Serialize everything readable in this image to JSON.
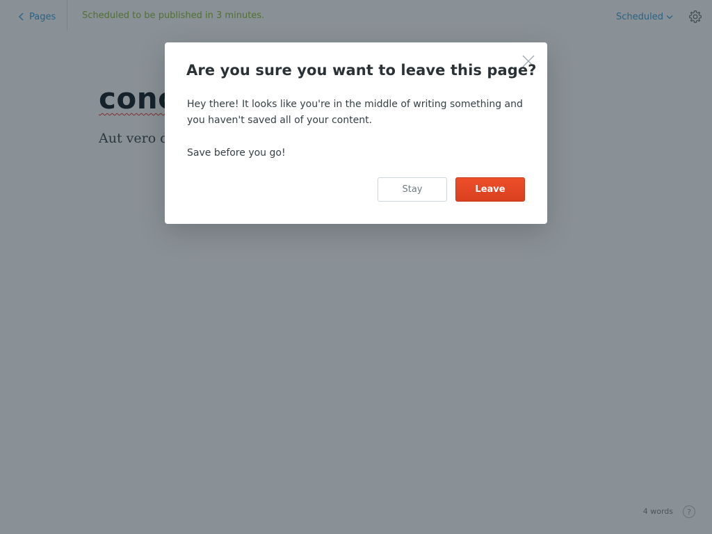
{
  "topbar": {
    "back_label": "Pages",
    "status_text": "Scheduled to be published in 3 minutes.",
    "status_menu_label": "Scheduled"
  },
  "editor": {
    "title": "conc",
    "body": "Aut vero de"
  },
  "footer": {
    "word_count": "4 words",
    "help_label": "?"
  },
  "modal": {
    "title": "Are you sure you want to leave this page?",
    "paragraphs": [
      "Hey there! It looks like you're in the middle of writing something and you haven't saved all of your content.",
      "Save before you go!"
    ],
    "stay_label": "Stay",
    "leave_label": "Leave"
  },
  "colors": {
    "accent_blue": "#3fa1dc",
    "status_green": "#8bbd3a",
    "danger_red": "#e2452a",
    "overlay": "rgba(21,35,46,0.5)"
  },
  "icons": {
    "back": "chevron-left-icon",
    "status_menu": "chevron-down-icon",
    "settings": "gear-icon",
    "close": "close-icon"
  }
}
